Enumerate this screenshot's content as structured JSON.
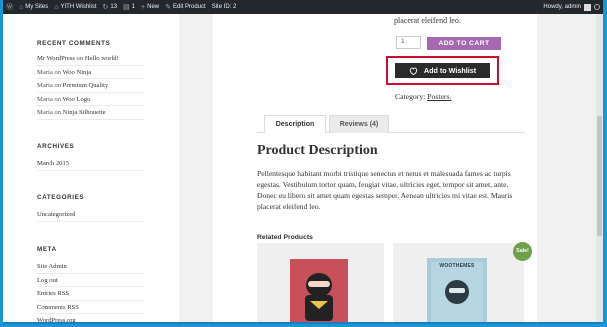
{
  "adminbar": {
    "my_sites": "My Sites",
    "site_name": "YITH Wishlist",
    "updates_count": "13",
    "comments_count": "1",
    "new_label": "New",
    "edit_label": "Edit Product",
    "site_id": "Site ID: 2",
    "howdy": "Howdy, admin"
  },
  "sidebar": {
    "recent_comments": {
      "title": "RECENT COMMENTS",
      "items": [
        {
          "author": "Mr WordPress",
          "on": "on",
          "post": "Hello world!"
        },
        {
          "author": "Maria",
          "on": "on",
          "post": "Woo Ninja"
        },
        {
          "author": "Maria",
          "on": "on",
          "post": "Premium Quality"
        },
        {
          "author": "Maria",
          "on": "on",
          "post": "Woo Logo"
        },
        {
          "author": "Maria",
          "on": "on",
          "post": "Ninja Silhouette"
        }
      ]
    },
    "archives": {
      "title": "ARCHIVES",
      "items": [
        "March 2015"
      ]
    },
    "categories": {
      "title": "CATEGORIES",
      "items": [
        "Uncategorized"
      ]
    },
    "meta": {
      "title": "META",
      "items": [
        "Site Admin",
        "Log out",
        "Entries RSS",
        "Comments RSS",
        "WordPress.org"
      ]
    }
  },
  "product": {
    "top_text": "placerat eleifend leo.",
    "quantity": "1",
    "add_to_cart": "ADD TO CART",
    "wishlist_label": "Add to Wishlist",
    "category_label": "Category:",
    "category_link": "Posters.",
    "tabs": [
      "Description",
      "Reviews (4)"
    ],
    "description_title": "Product Description",
    "description_text": "Pellentesque habitant morbi tristique senectus et netus et malesuada fames ac turpis egestas. Vestibulum tortor quam, feugiat vitae, ultricies eget, tempor sit amet, ante. Donec eu libero sit amet quam egestas semper. Aenean ultricies mi vitae est. Mauris placerat eleifend leo.",
    "related_title": "Related Products",
    "related": [
      {
        "poster_text": ""
      },
      {
        "poster_text": "WOOTHEMES",
        "badge": "Sale!"
      }
    ]
  },
  "colors": {
    "accent_purple": "#a569b0",
    "wishlist_button": "#2b2b2b",
    "highlight_red": "#c8102e",
    "sale_green": "#6ea04e",
    "admin_bar": "#23282d",
    "frame_blue": "#1a96d3"
  }
}
